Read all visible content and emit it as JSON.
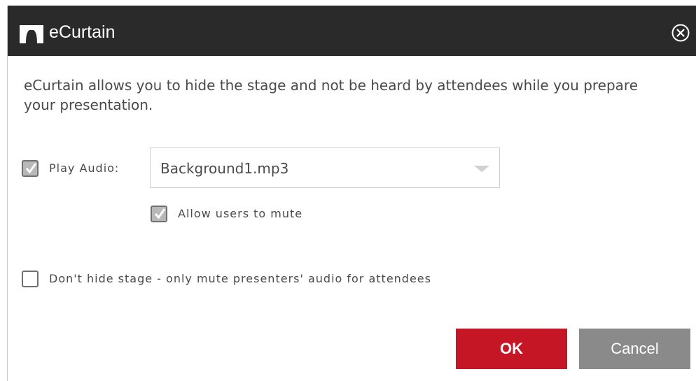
{
  "dialog": {
    "title": "eCurtain",
    "description": "eCurtain allows you to hide the stage and not be heard by attendees while you prepare your presentation."
  },
  "play_audio": {
    "label": "Play Audio:",
    "checked": true,
    "selected_file": "Background1.mp3"
  },
  "allow_mute": {
    "label": "Allow users to mute",
    "checked": true
  },
  "dont_hide": {
    "label": "Don't hide stage - only mute presenters' audio for attendees",
    "checked": false
  },
  "buttons": {
    "ok_label": "OK",
    "cancel_label": "Cancel"
  },
  "colors": {
    "titlebar": "#2a2a2a",
    "ok": "#c41624",
    "cancel": "#8a8a8a"
  }
}
